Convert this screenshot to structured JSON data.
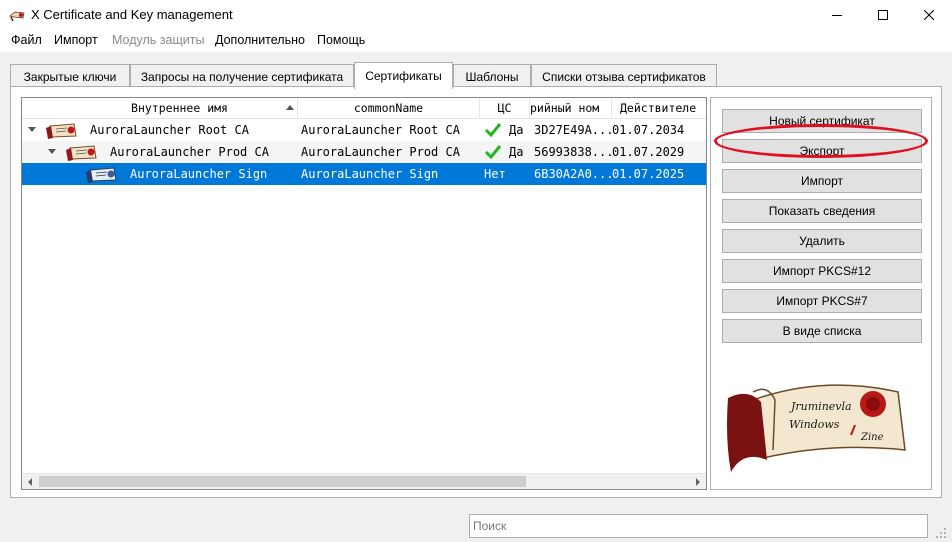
{
  "window": {
    "title": "X Certificate and Key management"
  },
  "menu": [
    "Файл",
    "Импорт",
    "Модуль защиты",
    "Дополнительно",
    "Помощь"
  ],
  "tabs": [
    "Закрытые ключи",
    "Запросы на получение сертификата",
    "Сертификаты",
    "Шаблоны",
    "Списки отзыва сертификатов"
  ],
  "columns": [
    "Внутреннее имя",
    "commonName",
    "ЦС",
    "рийный ном",
    "Действителе"
  ],
  "rows": [
    {
      "name": "AuroraLauncher Root CA",
      "cn": "AuroraLauncher Root CA",
      "ca": "Да",
      "serial": "3D27E49A...",
      "valid": "01.07.2034"
    },
    {
      "name": "AuroraLauncher Prod CA",
      "cn": "AuroraLauncher Prod CA",
      "ca": "Да",
      "serial": "56993838...",
      "valid": "01.07.2029"
    },
    {
      "name": "AuroraLauncher Sign",
      "cn": "AuroraLauncher Sign",
      "ca": "Нет",
      "serial": "6B30A2A0...",
      "valid": "01.07.2025"
    }
  ],
  "buttons": [
    "Новый сертификат",
    "Экспорт",
    "Импорт",
    "Показать сведения",
    "Удалить",
    "Импорт PKCS#12",
    "Импорт PKCS#7",
    "В виде списка"
  ],
  "logo": {
    "line1": "Jruminevla",
    "line2": "Windows",
    "line3": "Zine"
  },
  "search": {
    "placeholder": "Поиск"
  },
  "colors": {
    "selection": "#0078d7",
    "annotation": "#e01020",
    "check": "#1eb81e"
  },
  "icons": [
    "certificate-icon",
    "check-icon",
    "expand-arrow-icon"
  ]
}
